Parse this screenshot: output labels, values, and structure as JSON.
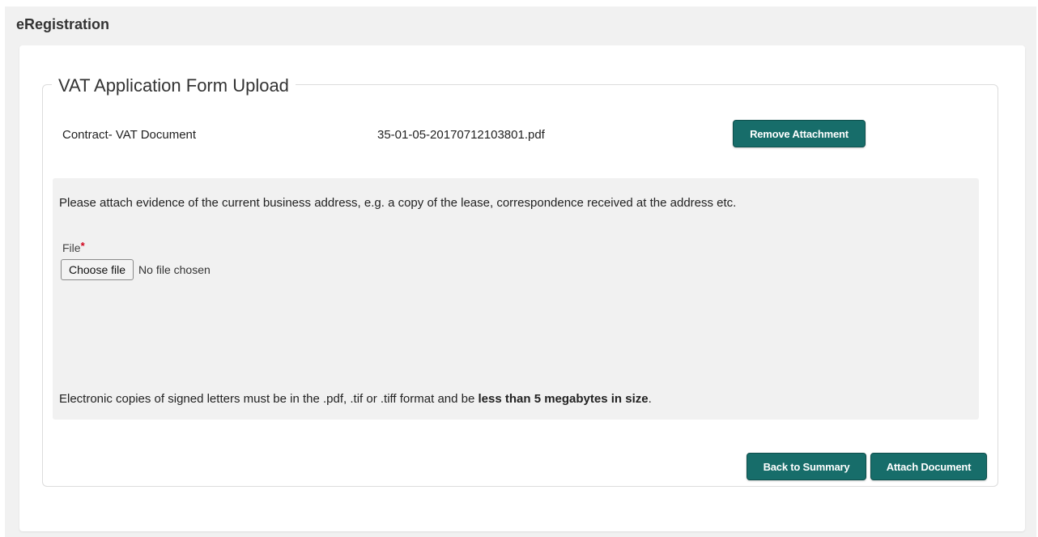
{
  "app": {
    "title": "eRegistration"
  },
  "form": {
    "legend": "VAT Application Form Upload",
    "attachment": {
      "label": "Contract- VAT Document",
      "filename": "35-01-05-20170712103801.pdf",
      "remove_label": "Remove Attachment"
    },
    "instruction": "Please attach evidence of the current business address, e.g. a copy of the lease, correspondence received at the address etc.",
    "file_field": {
      "label": "File",
      "required_marker": "*",
      "choose_label": "Choose file",
      "status": "No file chosen"
    },
    "note": {
      "prefix": "Electronic copies of signed letters must be in the .pdf, .tif or .tiff format and be ",
      "bold": "less than 5 megabytes in size",
      "suffix": "."
    },
    "buttons": {
      "back": "Back to Summary",
      "attach": "Attach Document"
    }
  },
  "colors": {
    "accent": "#176d6a",
    "panel_bg": "#f1f1f1",
    "required": "#d0021b"
  }
}
